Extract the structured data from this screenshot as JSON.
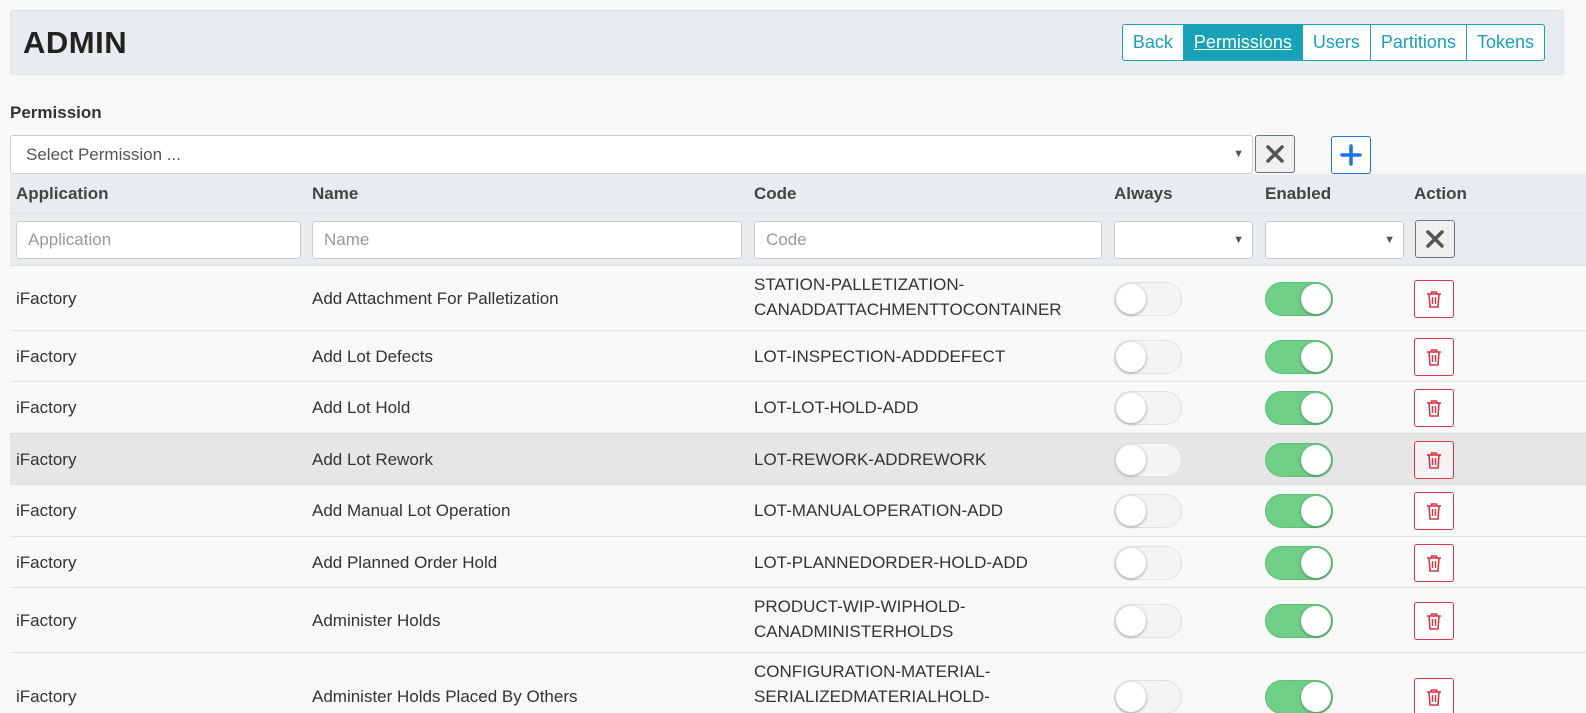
{
  "header": {
    "title": "ADMIN",
    "nav": [
      {
        "label": "Back",
        "active": false
      },
      {
        "label": "Permissions",
        "active": true
      },
      {
        "label": "Users",
        "active": false
      },
      {
        "label": "Partitions",
        "active": false
      },
      {
        "label": "Tokens",
        "active": false
      }
    ]
  },
  "permission": {
    "label": "Permission",
    "placeholder": "Select Permission ..."
  },
  "table": {
    "columns": [
      "Application",
      "Name",
      "Code",
      "Always",
      "Enabled",
      "Action"
    ],
    "filters": {
      "application_placeholder": "Application",
      "name_placeholder": "Name",
      "code_placeholder": "Code"
    },
    "rows": [
      {
        "application": "iFactory",
        "name": "Add Attachment For Palletization",
        "code_lines": [
          "STATION-PALLETIZATION-",
          "CANADDATTACHMENTTOCONTAINER"
        ],
        "always": false,
        "enabled": true
      },
      {
        "application": "iFactory",
        "name": "Add Lot Defects",
        "code_lines": [
          "LOT-INSPECTION-ADDDEFECT"
        ],
        "always": false,
        "enabled": true
      },
      {
        "application": "iFactory",
        "name": "Add Lot Hold",
        "code_lines": [
          "LOT-LOT-HOLD-ADD"
        ],
        "always": false,
        "enabled": true
      },
      {
        "application": "iFactory",
        "name": "Add Lot Rework",
        "code_lines": [
          "LOT-REWORK-ADDREWORK"
        ],
        "always": false,
        "enabled": true
      },
      {
        "application": "iFactory",
        "name": "Add Manual Lot Operation",
        "code_lines": [
          "LOT-MANUALOPERATION-ADD"
        ],
        "always": false,
        "enabled": true
      },
      {
        "application": "iFactory",
        "name": "Add Planned Order Hold",
        "code_lines": [
          "LOT-PLANNEDORDER-HOLD-ADD"
        ],
        "always": false,
        "enabled": true
      },
      {
        "application": "iFactory",
        "name": "Administer Holds",
        "code_lines": [
          "PRODUCT-WIP-WIPHOLD-",
          "CANADMINISTERHOLDS"
        ],
        "always": false,
        "enabled": true
      },
      {
        "application": "iFactory",
        "name": "Administer Holds Placed By Others",
        "code_lines": [
          "CONFIGURATION-MATERIAL-",
          "SERIALIZEDMATERIALHOLD-"
        ],
        "always": false,
        "enabled": true
      }
    ]
  },
  "colors": {
    "nav_accent": "#17a2b8",
    "add_accent": "#1a73e8",
    "delete_accent": "#dc3545",
    "toggle_on": "#6fcf86"
  },
  "icons": {
    "clear": "close-icon",
    "add": "plus-icon",
    "delete": "trash-icon",
    "dropdown": "caret-down-icon"
  }
}
